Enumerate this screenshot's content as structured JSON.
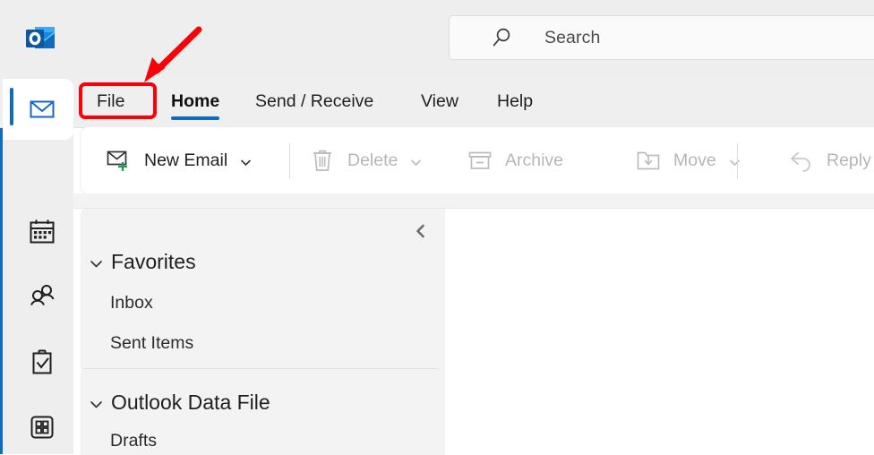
{
  "app": {
    "name": "Microsoft Outlook",
    "logo_icon": "outlook-logo-icon",
    "accent_color": "#0f6cbd"
  },
  "search": {
    "icon": "search-icon",
    "placeholder": "Search",
    "value": ""
  },
  "ribbon_tabs": [
    {
      "label": "File",
      "active": false
    },
    {
      "label": "Home",
      "active": true
    },
    {
      "label": "Send / Receive",
      "active": false
    },
    {
      "label": "View",
      "active": false
    },
    {
      "label": "Help",
      "active": false
    }
  ],
  "nav_rail": [
    {
      "label": "Mail",
      "icon": "mail-envelope-icon",
      "selected": true
    },
    {
      "label": "Calendar",
      "icon": "calendar-icon",
      "selected": false
    },
    {
      "label": "People",
      "icon": "people-icon",
      "selected": false
    },
    {
      "label": "To Do",
      "icon": "tasks-clipboard-check-icon",
      "selected": false
    },
    {
      "label": "More apps",
      "icon": "apps-grid-icon",
      "selected": false
    }
  ],
  "toolbar": {
    "commands": [
      {
        "label": "New Email",
        "icon": "new-email-icon",
        "disabled": false,
        "has_caret": true
      },
      {
        "label": "Delete",
        "icon": "trash-icon",
        "disabled": true,
        "has_caret": true
      },
      {
        "label": "Archive",
        "icon": "archive-box-icon",
        "disabled": true,
        "has_caret": false
      },
      {
        "label": "Move",
        "icon": "move-folder-icon",
        "disabled": true,
        "has_caret": true
      },
      {
        "label": "Reply",
        "icon": "reply-arrow-icon",
        "disabled": true,
        "has_caret": false
      }
    ]
  },
  "folder_pane": {
    "collapse_icon": "chevron-left-icon",
    "groups": [
      {
        "label": "Favorites",
        "expanded": true,
        "chevron_icon": "chevron-down-icon",
        "items": [
          {
            "label": "Inbox"
          },
          {
            "label": "Sent Items"
          }
        ]
      },
      {
        "label": "Outlook Data File",
        "expanded": true,
        "chevron_icon": "chevron-down-icon",
        "items": [
          {
            "label": "Drafts"
          }
        ]
      }
    ]
  },
  "annotation": {
    "color": "#fb0007",
    "highlight_target": "File",
    "arrow_icon": "red-pointer-arrow-icon",
    "box_icon": "red-highlight-box-icon"
  }
}
